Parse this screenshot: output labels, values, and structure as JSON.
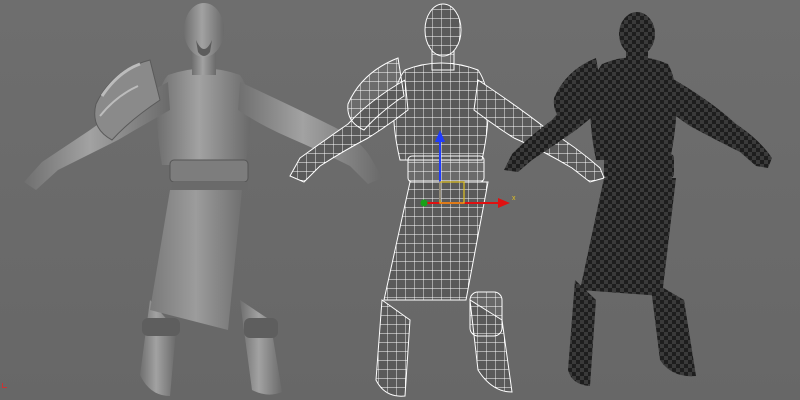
{
  "viewport": {
    "background_color": "#6b6b6b",
    "models": [
      {
        "name": "shaded-model",
        "render_mode": "smooth-shaded",
        "color": "#8f8f8f"
      },
      {
        "name": "wireframe-model",
        "render_mode": "wireframe",
        "color": "#ffffff"
      },
      {
        "name": "uv-checker-model",
        "render_mode": "checker-textured",
        "color": "#2b2b2b"
      }
    ]
  },
  "gizmo": {
    "y_axis_color": "#1f3bff",
    "x_axis_color": "#e01010",
    "z_axis_color": "#18a018",
    "x_label": "x"
  }
}
